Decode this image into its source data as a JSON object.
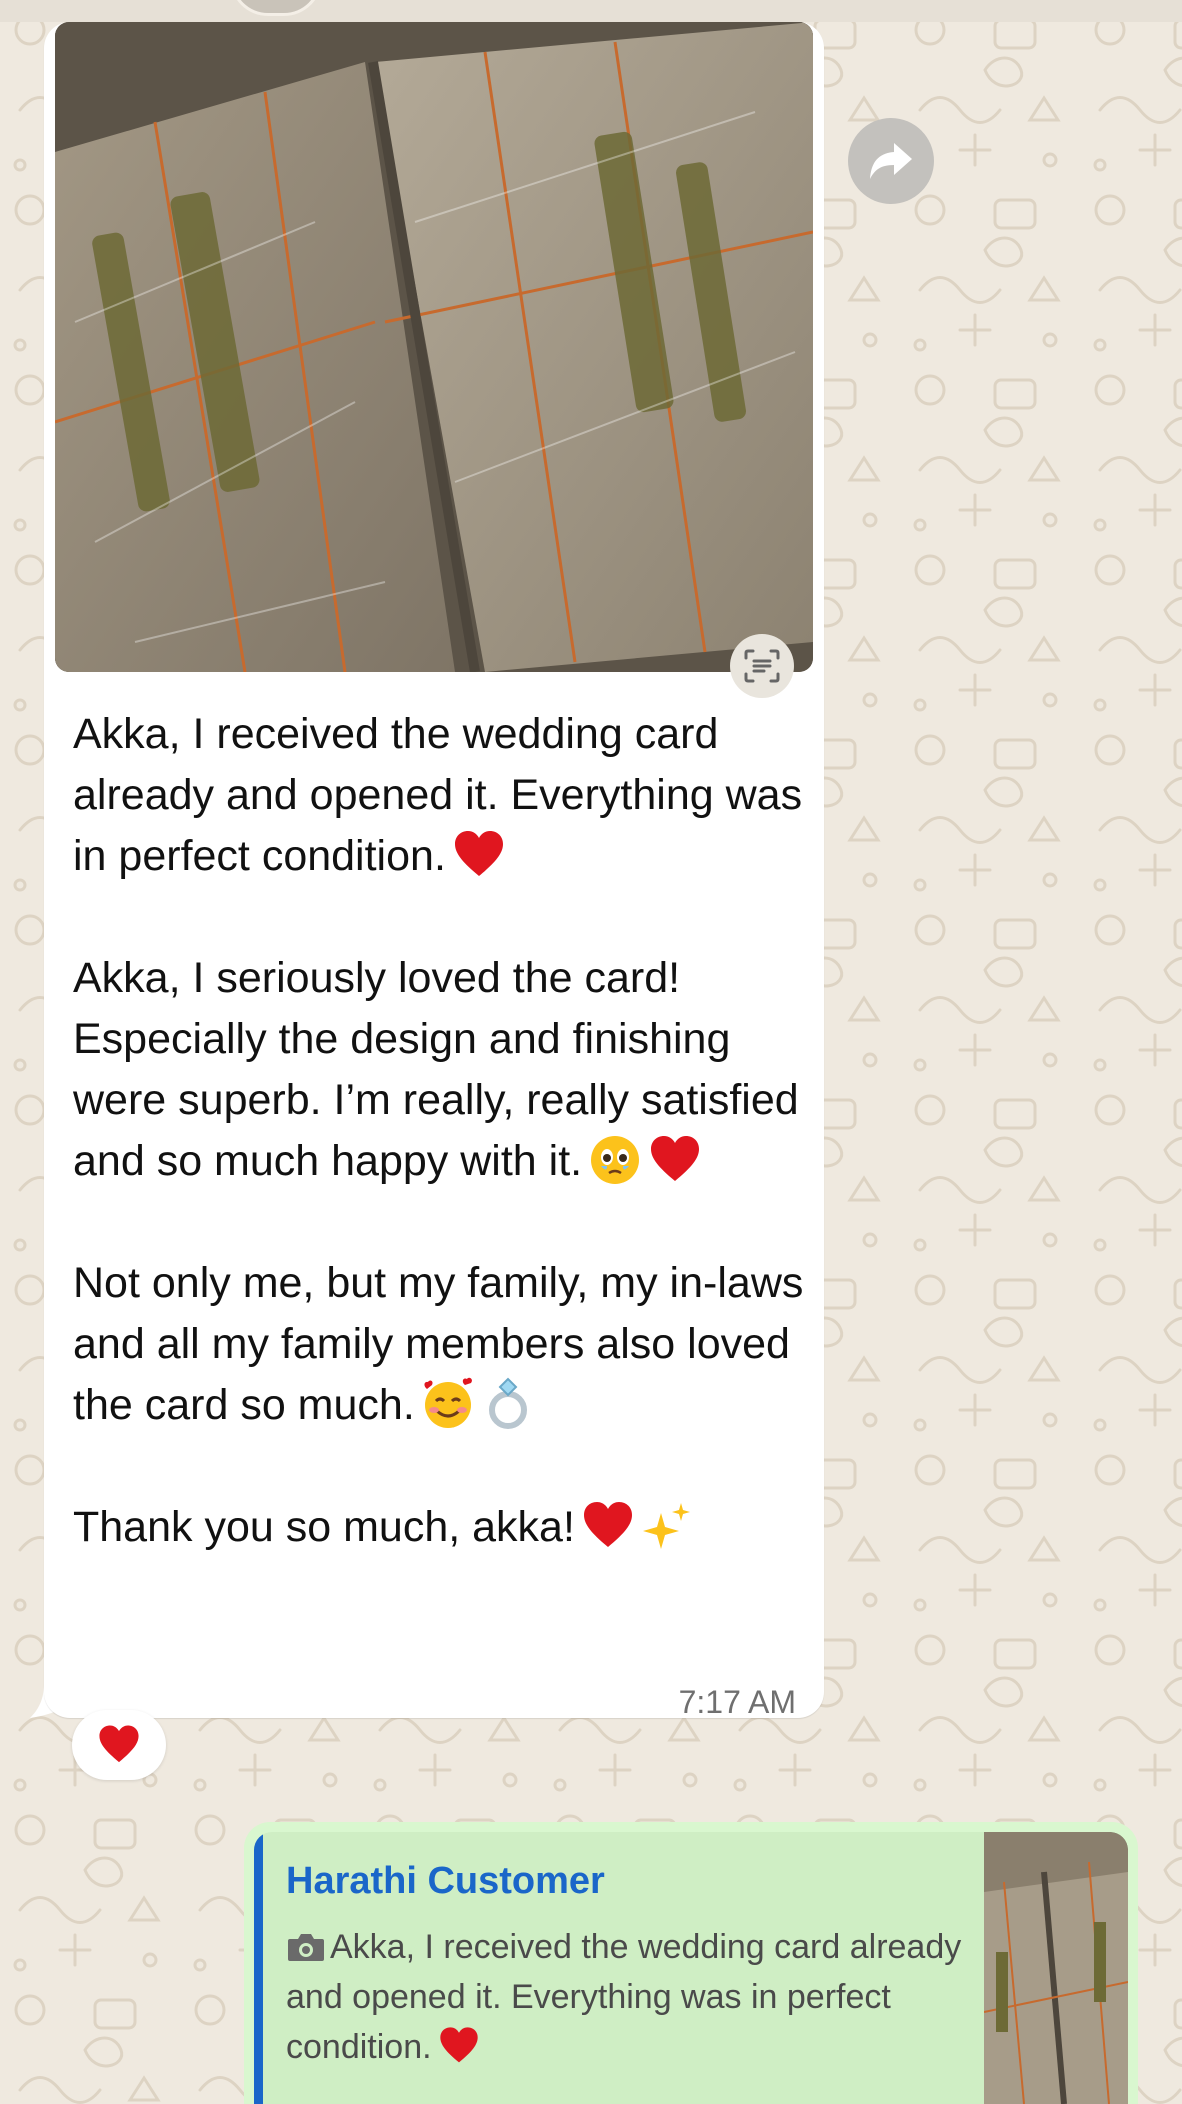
{
  "chat": {
    "incoming_message": {
      "paragraphs": [
        {
          "text": "Akka, I received the wedding card already and opened it. Everything was in perfect condition.",
          "emojis": [
            "red-heart"
          ]
        },
        {
          "text": "Akka, I seriously loved the card! Especially the design and finishing were superb. I’m really, really satisfied and so much happy with it.",
          "emojis": [
            "face-holding-back-tears",
            "red-heart"
          ]
        },
        {
          "text": "Not only me, but my family, my in-laws and all my family members also loved the card so much.",
          "emojis": [
            "smiling-face-with-hearts",
            "ring"
          ]
        },
        {
          "text": "Thank you so much, akka!",
          "emojis": [
            "red-heart",
            "sparkles"
          ]
        }
      ],
      "time": "7:17 AM",
      "reaction": "red-heart"
    },
    "outgoing_reply": {
      "quoted_author": "Harathi Customer",
      "quoted_text": "Akka, I received the wedding card already and opened it. Everything was in perfect condition.",
      "quoted_icon": "camera-icon",
      "quoted_emoji": "red-heart"
    }
  },
  "colors": {
    "wallpaper": "#efe9df",
    "incoming_bubble": "#ffffff",
    "outgoing_bubble": "#d9f7cf",
    "quote_accent": "#1a66c9",
    "heart": "#e0161f"
  },
  "icons": {
    "forward": "forward-arrow-icon",
    "live_text": "live-text-icon"
  }
}
